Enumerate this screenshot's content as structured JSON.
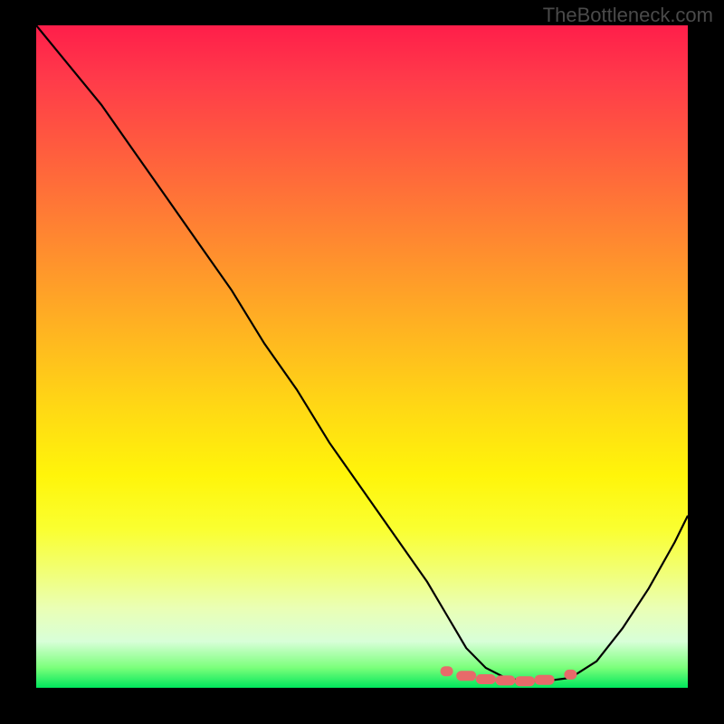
{
  "watermark": "TheBottleneck.com",
  "chart_data": {
    "type": "line",
    "title": "",
    "xlabel": "",
    "ylabel": "",
    "xlim": [
      0,
      100
    ],
    "ylim": [
      0,
      100
    ],
    "series": [
      {
        "name": "bottleneck-curve",
        "x": [
          0,
          5,
          10,
          15,
          20,
          25,
          30,
          35,
          40,
          45,
          50,
          55,
          60,
          63,
          66,
          69,
          72,
          75,
          78,
          82,
          86,
          90,
          94,
          98,
          100
        ],
        "values": [
          100,
          94,
          88,
          81,
          74,
          67,
          60,
          52,
          45,
          37,
          30,
          23,
          16,
          11,
          6,
          3,
          1.5,
          1,
          1,
          1.5,
          4,
          9,
          15,
          22,
          26
        ]
      }
    ],
    "markers": {
      "name": "optimal-range",
      "x": [
        63,
        66,
        69,
        72,
        75,
        78,
        82
      ],
      "values": [
        2.5,
        1.8,
        1.3,
        1.1,
        1.0,
        1.2,
        2.0
      ],
      "color": "#e76a6a"
    },
    "gradient_stops": [
      {
        "pos": 0,
        "color": "#ff1e4a"
      },
      {
        "pos": 18,
        "color": "#ff5a3f"
      },
      {
        "pos": 38,
        "color": "#ff9a2a"
      },
      {
        "pos": 58,
        "color": "#ffd914"
      },
      {
        "pos": 76,
        "color": "#faff30"
      },
      {
        "pos": 93,
        "color": "#d8ffd8"
      },
      {
        "pos": 100,
        "color": "#00e65c"
      }
    ]
  }
}
